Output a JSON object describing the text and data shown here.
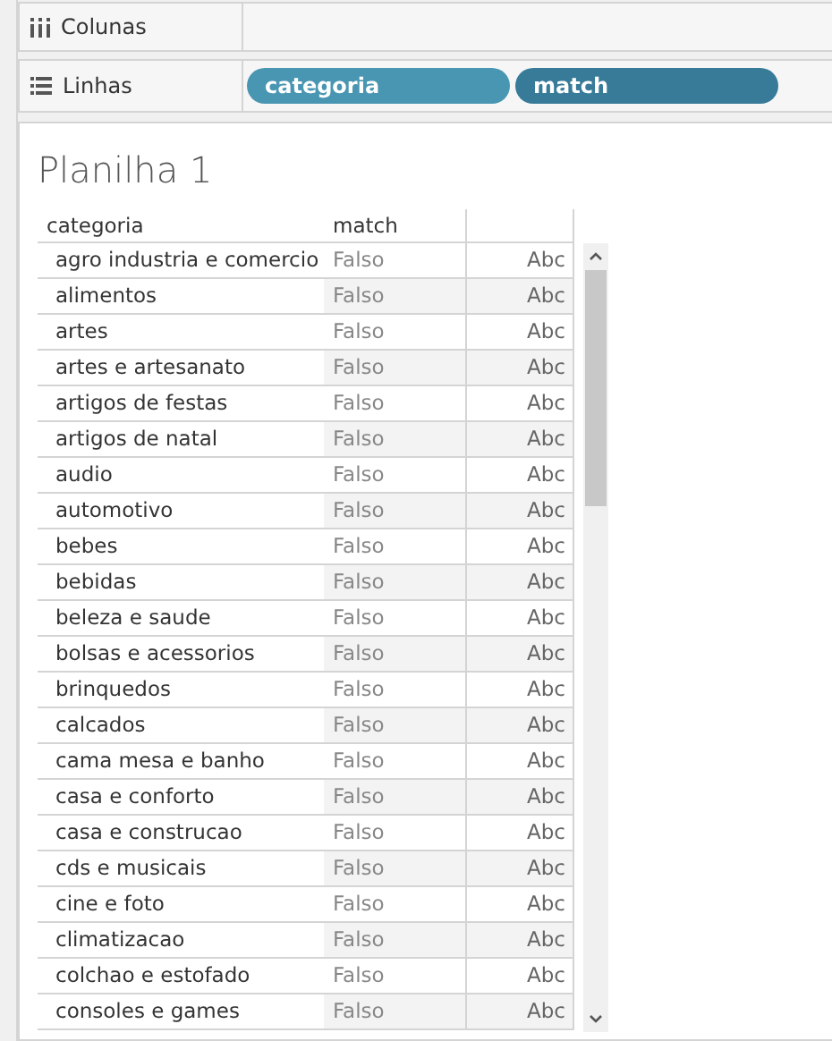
{
  "shelves": [
    {
      "kind": "columns",
      "label": "Colunas"
    },
    {
      "kind": "rows",
      "label": "Linhas",
      "pills": [
        {
          "label": "categoria",
          "color": "#4996b2"
        },
        {
          "label": "match",
          "color": "#377b99"
        }
      ]
    }
  ],
  "sheet": {
    "title": "Planilha 1",
    "table": {
      "columns": [
        "categoria",
        "match"
      ],
      "rows": [
        {
          "categoria": "agro industria e comercio",
          "match": "Falso",
          "column_3": "Abc"
        },
        {
          "categoria": "alimentos",
          "match": "Falso",
          "column_3": "Abc"
        },
        {
          "categoria": "artes",
          "match": "Falso",
          "column_3": "Abc"
        },
        {
          "categoria": "artes e artesanato",
          "match": "Falso",
          "column_3": "Abc"
        },
        {
          "categoria": "artigos de festas",
          "match": "Falso",
          "column_3": "Abc"
        },
        {
          "categoria": "artigos de natal",
          "match": "Falso",
          "column_3": "Abc"
        },
        {
          "categoria": "audio",
          "match": "Falso",
          "column_3": "Abc"
        },
        {
          "categoria": "automotivo",
          "match": "Falso",
          "column_3": "Abc"
        },
        {
          "categoria": "bebes",
          "match": "Falso",
          "column_3": "Abc"
        },
        {
          "categoria": "bebidas",
          "match": "Falso",
          "column_3": "Abc"
        },
        {
          "categoria": "beleza e saude",
          "match": "Falso",
          "column_3": "Abc"
        },
        {
          "categoria": "bolsas e acessorios",
          "match": "Falso",
          "column_3": "Abc"
        },
        {
          "categoria": "brinquedos",
          "match": "Falso",
          "column_3": "Abc"
        },
        {
          "categoria": "calcados",
          "match": "Falso",
          "column_3": "Abc"
        },
        {
          "categoria": "cama mesa e banho",
          "match": "Falso",
          "column_3": "Abc"
        },
        {
          "categoria": "casa e conforto",
          "match": "Falso",
          "column_3": "Abc"
        },
        {
          "categoria": "casa e construcao",
          "match": "Falso",
          "column_3": "Abc"
        },
        {
          "categoria": "cds e musicais",
          "match": "Falso",
          "column_3": "Abc"
        },
        {
          "categoria": "cine e foto",
          "match": "Falso",
          "column_3": "Abc"
        },
        {
          "categoria": "climatizacao",
          "match": "Falso",
          "column_3": "Abc"
        },
        {
          "categoria": "colchao e estofado",
          "match": "Falso",
          "column_3": "Abc"
        },
        {
          "categoria": "consoles e games",
          "match": "Falso",
          "column_3": "Abc"
        }
      ]
    }
  }
}
